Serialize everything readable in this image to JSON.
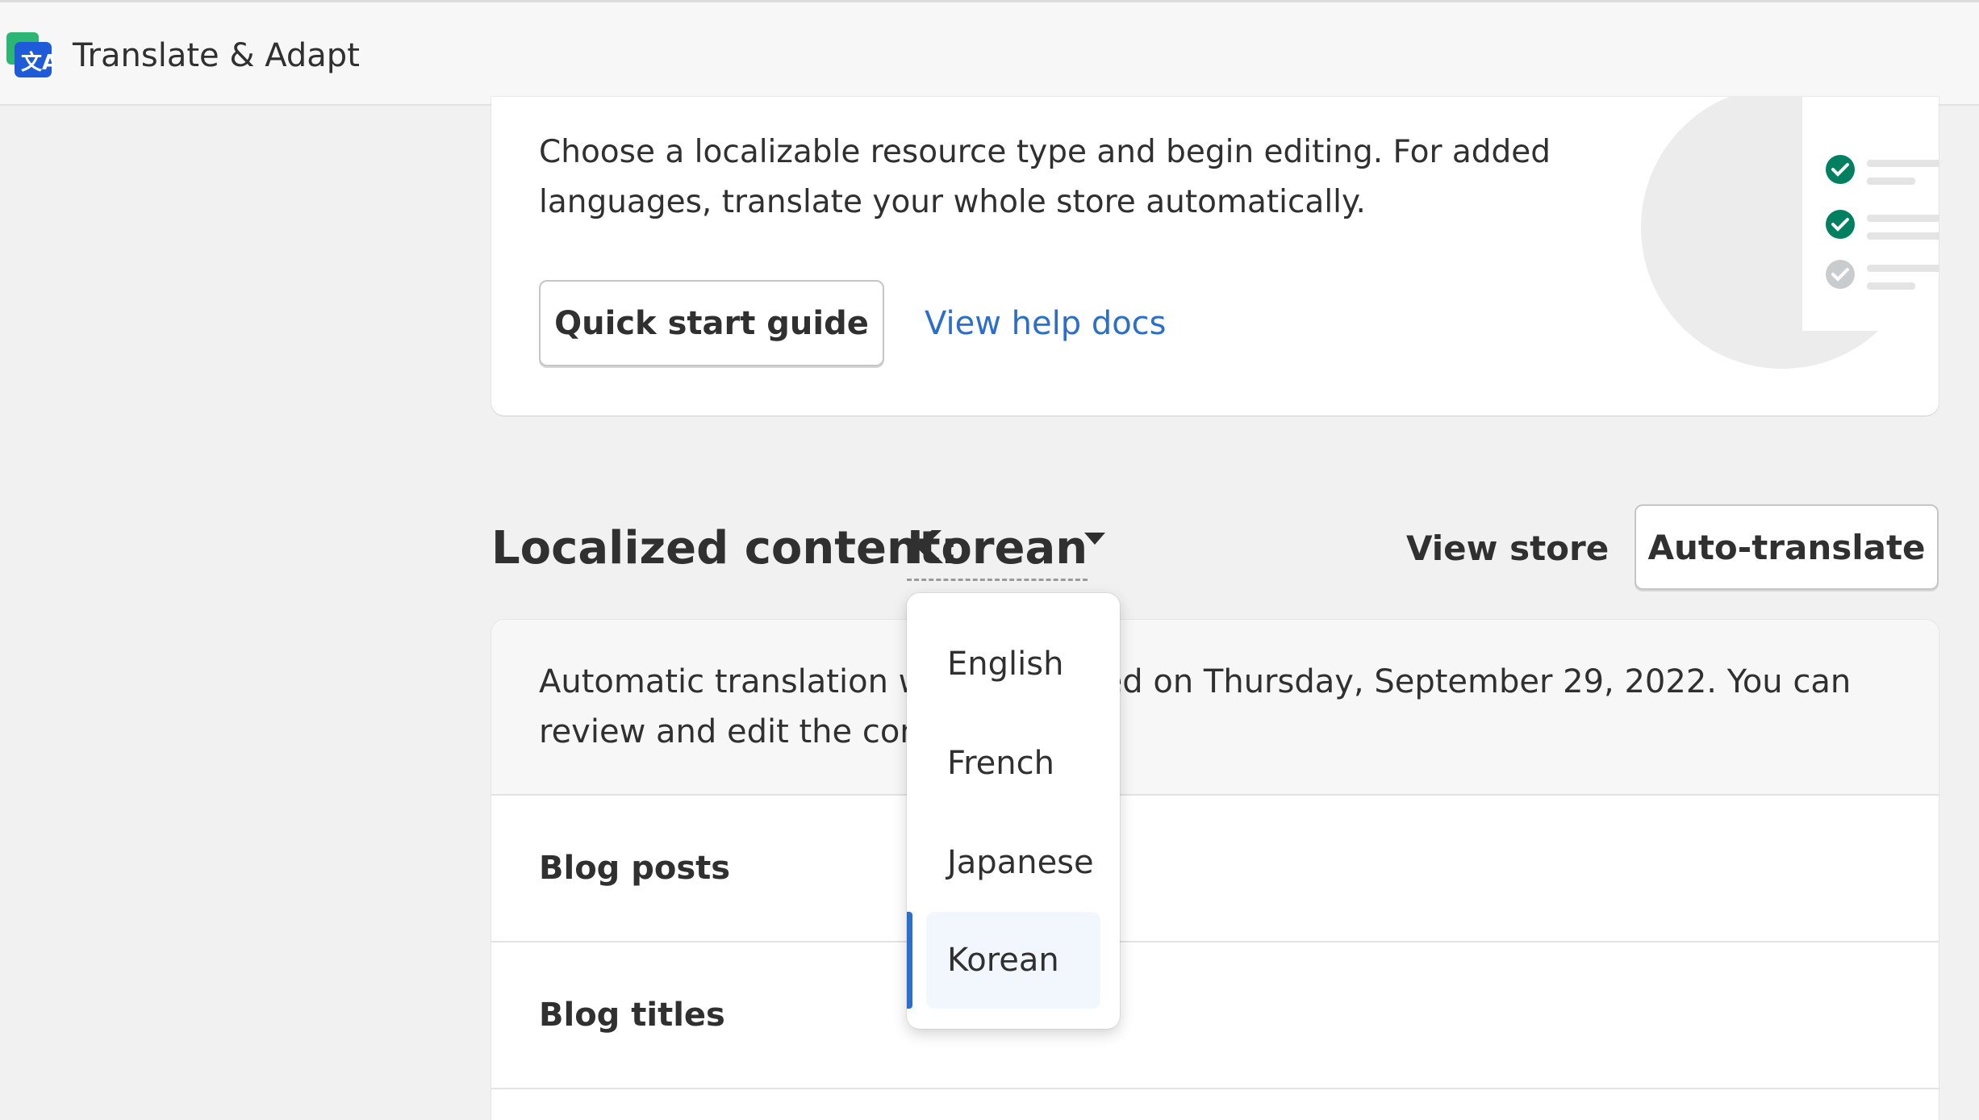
{
  "header": {
    "app_title": "Translate & Adapt",
    "app_icon": "translate-icon"
  },
  "intro": {
    "text": "Choose a localizable resource type and begin editing. For added languages, translate your whole store automatically.",
    "quick_start_label": "Quick start guide",
    "help_link_label": "View help docs"
  },
  "localized": {
    "title": "Localized content:",
    "selected_language": "Korean",
    "view_store_label": "View store",
    "auto_translate_label": "Auto-translate",
    "notice_text": "Automatic translation was completed on Thursday, September 29, 2022. You can review and edit the content below.",
    "rows": [
      {
        "label": "Blog posts"
      },
      {
        "label": "Blog titles"
      }
    ]
  },
  "language_menu": {
    "options": [
      "English",
      "French",
      "Japanese",
      "Korean"
    ],
    "selected": "Korean"
  },
  "colors": {
    "accent": "#2c6ecb",
    "success": "#008060",
    "disabled": "#c9cccf"
  }
}
